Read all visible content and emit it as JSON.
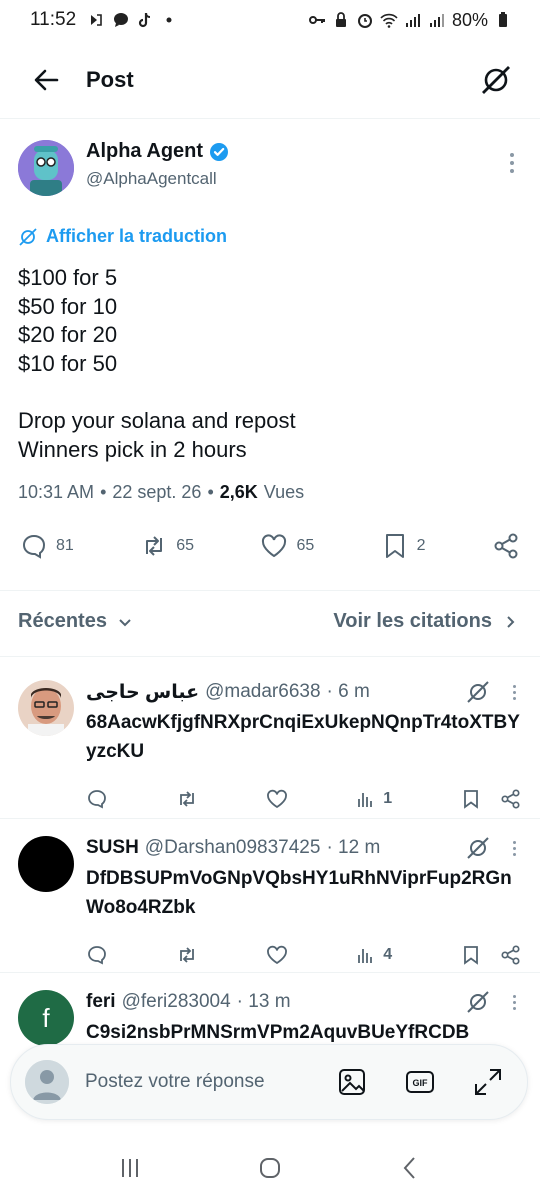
{
  "status": {
    "time": "11:52",
    "battery": "80%"
  },
  "header": {
    "title": "Post"
  },
  "post": {
    "author_name": "Alpha Agent",
    "author_handle": "@AlphaAgentcall",
    "translate_label": "Afficher la traduction",
    "text": "$100 for 5\n$50 for 10\n$20 for 20\n$10 for 50\n\nDrop your solana and repost\nWinners pick in 2 hours",
    "time": "10:31 AM",
    "date": "22 sept. 26",
    "views_count": "2,6K",
    "views_label": "Vues",
    "replies": "81",
    "reposts": "65",
    "likes": "65",
    "bookmarks": "2"
  },
  "sort": {
    "label": "Récentes",
    "quotes_label": "Voir les citations"
  },
  "replies": [
    {
      "name": "عباس حاجی",
      "handle": "@madar6638",
      "age": "· 6 m",
      "text": "68AacwKfjgfNRXprCnqiExUkepNQnpTr4toXTBYyzcKU",
      "views": "1"
    },
    {
      "name": "SUSH",
      "handle": "@Darshan09837425",
      "age": "· 12 m",
      "text": "DfDBSUPmVoGNpVQbsHY1uRhNViprFup2RGnWo8o4RZbk",
      "views": "4"
    },
    {
      "name": "feri",
      "handle": "@feri283004",
      "age": "· 13 m",
      "text": "C9si2nsbPrMNSrmVPm2AquvBUeYfRCDB",
      "avatar_letter": "f"
    }
  ],
  "compose": {
    "placeholder": "Postez votre réponse"
  },
  "colors": {
    "accent": "#1d9bf0",
    "text": "#0f1419",
    "muted": "#536471"
  },
  "icons": [
    "back-arrow-icon",
    "grok-icon",
    "verified-badge-icon",
    "translate-icon",
    "reply-icon",
    "repost-icon",
    "like-icon",
    "bookmark-icon",
    "share-icon",
    "views-icon",
    "image-icon",
    "gif-icon",
    "expand-icon",
    "recents-icon",
    "home-icon",
    "back-icon"
  ]
}
